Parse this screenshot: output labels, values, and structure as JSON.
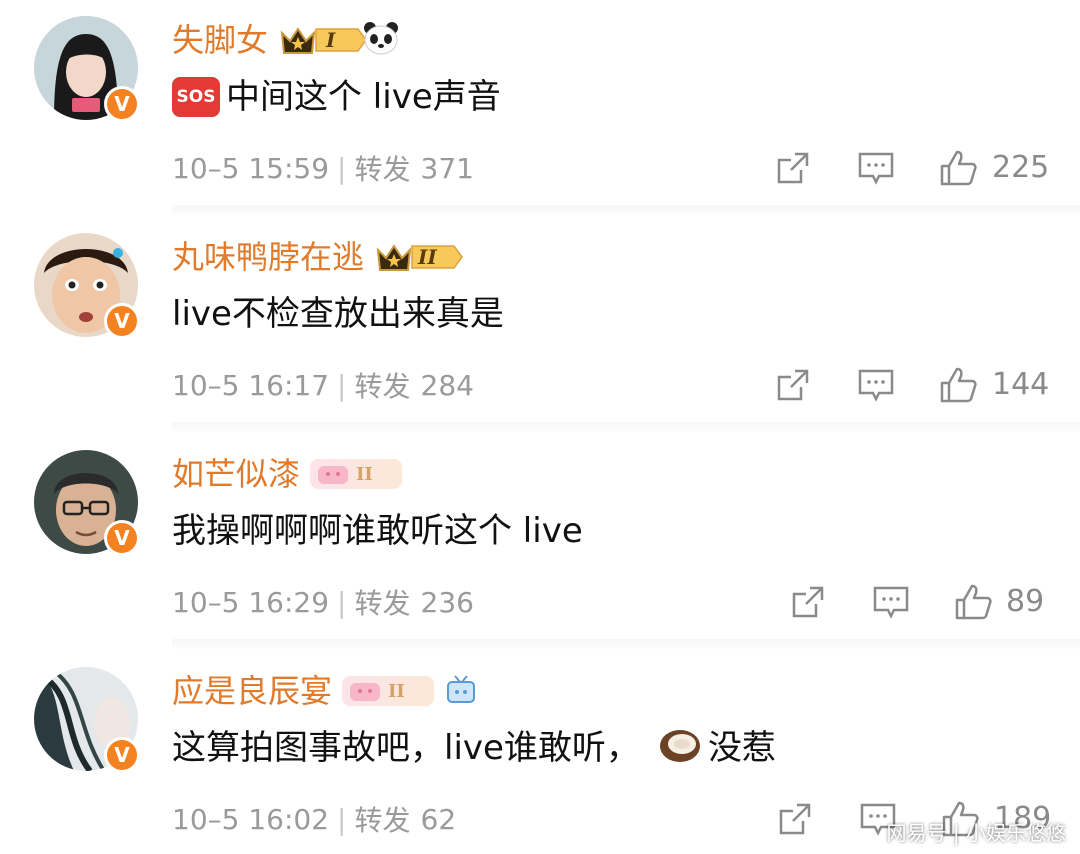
{
  "comments": [
    {
      "username": "失脚女",
      "level_badge": "I",
      "has_panda_icon": true,
      "text": "中间这个 live声音",
      "date": "10–5 15:59",
      "repost_label": "转发",
      "repost_count": "371",
      "like_count": "225"
    },
    {
      "username": "丸味鸭脖在逃",
      "level_badge": "II",
      "text": "live不检查放出来真是",
      "date": "10–5 16:17",
      "repost_label": "转发",
      "repost_count": "284",
      "like_count": "144"
    },
    {
      "username": "如芒似漆",
      "level_badge": "II",
      "text": "我操啊啊啊谁敢听这个 live",
      "date": "10–5 16:29",
      "repost_label": "转发",
      "repost_count": "236",
      "like_count": "89"
    },
    {
      "username": "应是良辰宴",
      "level_badge": "II",
      "has_tv_icon": true,
      "text_before": "这算拍图事故吧，live谁敢听，",
      "text_after": "没惹",
      "date": "10–5 16:02",
      "repost_label": "转发",
      "repost_count": "62",
      "like_count": "189"
    }
  ],
  "sos_label": "SOS",
  "verified_mark": "V",
  "watermark": "网易号 | 小娱乐悠悠",
  "colors": {
    "username": "#e07b2c",
    "meta": "#9a9a9a",
    "verified": "#f58220",
    "sos": "#e53935"
  }
}
